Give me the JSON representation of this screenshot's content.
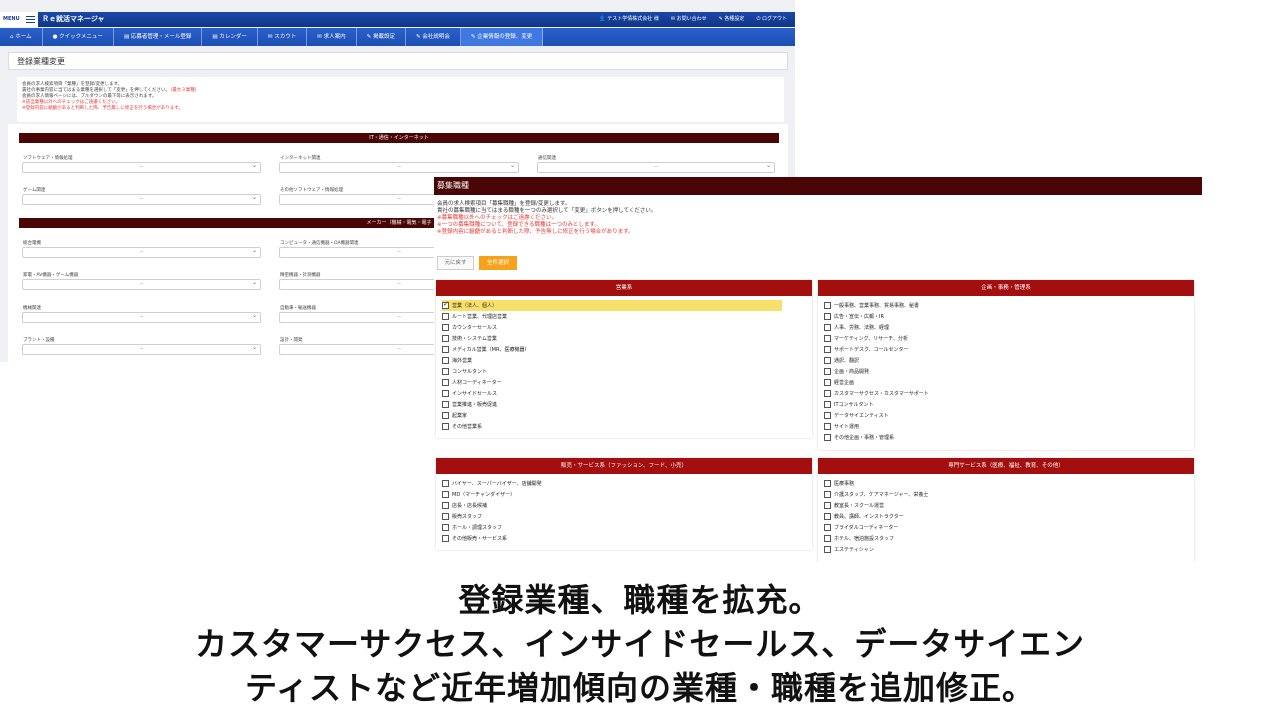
{
  "app": {
    "menu_label": "MENU",
    "title": "Ｒｅ就活マネージャ",
    "top_links": [
      "テスト学情株式会社 様",
      "お問い合わせ",
      "各種設定",
      "ログアウト"
    ]
  },
  "nav": {
    "items": [
      "ホーム",
      "クイックメニュー",
      "応募者管理・メール登録",
      "カレンダー",
      "スカウト",
      "求人案内",
      "掲載設定",
      "会社説明会",
      "企業情報の登録、変更"
    ]
  },
  "industry_page": {
    "title": "登録業種変更",
    "description": [
      {
        "text": "会員の求人検索項目「業種」を登録/変更します。",
        "note": "",
        "red": false
      },
      {
        "text": "貴社の事業内容に当てはまる業種を選択して「変更」を押してください。",
        "note": "（最大３業種）",
        "red": false
      },
      {
        "text": "会員の求人情報ページには、プルダウンの最下等に表示されます。",
        "note": "",
        "red": false
      },
      {
        "text": "※該当業種以外へのチェックはご遠慮ください。",
        "note": "",
        "red": true
      },
      {
        "text": "※登録内容に齟齬があると判断した際、予告無しに修正を行う場合があります。",
        "note": "",
        "red": true
      }
    ],
    "categories": [
      {
        "header": "IT・通信・インターネット",
        "fields": [
          "ソフトウェア・情報処理",
          "インターネット関連",
          "通信関連",
          "ゲーム関連",
          "その他ソフトウェア・情報処理"
        ]
      },
      {
        "header": "メーカー（機械・電気・電子",
        "fields": [
          "総合電機",
          "コンピュータ・通信機器・OA機器関連",
          "家電・AV機器・ゲーム機器",
          "精密機器・計測機器",
          "機械関連",
          "自動車・輸送機器",
          "プラント・設備",
          "設計・開発"
        ]
      }
    ],
    "select_placeholder": "--"
  },
  "job_modal": {
    "title": "募集職種",
    "description": [
      {
        "text": "会員の求人検索項目「募集職種」を登録/変更します。",
        "red": false
      },
      {
        "text": "貴社の募集職種に当てはまる職種を一つのみ選択して「変更」ボタンを押してください。",
        "red": false
      },
      {
        "text": "※募集職種以外へのチェックはご遠慮ください。",
        "red": true
      },
      {
        "text": "※一つの募集職種について、登録できる職種は一つのみとします。",
        "red": true
      },
      {
        "text": "※登録内容に齟齬があると判断した際、予告無しに修正を行う場合があります。",
        "red": true
      }
    ],
    "back_label": "元に戻す",
    "select_all_label": "全件選択",
    "panels": [
      {
        "header": "営業系",
        "items": [
          {
            "label": "営業（法人、個人）",
            "checked": true
          },
          {
            "label": "ルート営業、代理店営業",
            "checked": false
          },
          {
            "label": "カウンターセールス",
            "checked": false
          },
          {
            "label": "技術・システム営業",
            "checked": false
          },
          {
            "label": "メディカル営業（MR、医療機器）",
            "checked": false
          },
          {
            "label": "海外営業",
            "checked": false
          },
          {
            "label": "コンサルタント",
            "checked": false
          },
          {
            "label": "人材コーディネーター",
            "checked": false
          },
          {
            "label": "インサイドセールス",
            "checked": false
          },
          {
            "label": "営業推進・販売促進",
            "checked": false
          },
          {
            "label": "起業家",
            "checked": false
          },
          {
            "label": "その他営業系",
            "checked": false
          }
        ]
      },
      {
        "header": "企画・事務・管理系",
        "items": [
          {
            "label": "一般事務、営業事務、貿易事務、秘書",
            "checked": false
          },
          {
            "label": "広告・宣伝・広報・IR",
            "checked": false
          },
          {
            "label": "人事、労務、法務、経理",
            "checked": false
          },
          {
            "label": "マーケティング、リサーチ、分析",
            "checked": false
          },
          {
            "label": "サポートデスク、コールセンター",
            "checked": false
          },
          {
            "label": "通訳、翻訳",
            "checked": false
          },
          {
            "label": "企画・商品開発",
            "checked": false
          },
          {
            "label": "経営企画",
            "checked": false
          },
          {
            "label": "カスタマーサクセス・カスタマーサポート",
            "checked": false
          },
          {
            "label": "ITコンサルタント",
            "checked": false
          },
          {
            "label": "データサイエンティスト",
            "checked": false
          },
          {
            "label": "サイト運用",
            "checked": false
          },
          {
            "label": "その他企画・事務・管理系",
            "checked": false
          }
        ]
      },
      {
        "header": "販売・サービス系（ファッション、フード、小売）",
        "items": [
          {
            "label": "バイヤー、スーパーバイザー、店舗開発",
            "checked": false
          },
          {
            "label": "MD（マーチャンダイザー）",
            "checked": false
          },
          {
            "label": "店長・店長候補",
            "checked": false
          },
          {
            "label": "販売スタッフ",
            "checked": false
          },
          {
            "label": "ホール・調理スタッフ",
            "checked": false
          },
          {
            "label": "その他販売・サービス系",
            "checked": false
          }
        ]
      },
      {
        "header": "専門サービス系（医療、福祉、教育、その他）",
        "items": [
          {
            "label": "医療事務",
            "checked": false
          },
          {
            "label": "介護スタッフ、ケアマネージャー、栄養士",
            "checked": false
          },
          {
            "label": "教室長・スクール運営",
            "checked": false
          },
          {
            "label": "教員、講師、インストラクター",
            "checked": false
          },
          {
            "label": "ブライダルコーディネーター",
            "checked": false
          },
          {
            "label": "ホテル、宿泊施設スタッフ",
            "checked": false
          },
          {
            "label": "エステティシャン",
            "checked": false
          }
        ]
      }
    ]
  },
  "caption": {
    "lines": [
      "登録業種、職種を拡充。",
      "カスタマーサクセス、インサイドセールス、データサイエン",
      "ティストなど近年増加傾向の業種・職種を追加修正。"
    ]
  },
  "colors": {
    "header_dark_red": "#4a0505",
    "panel_red": "#a30f0f",
    "nav_blue": "#1c4fb5",
    "accent_orange": "#f6a21a",
    "highlight_yellow": "#f9e06a"
  }
}
